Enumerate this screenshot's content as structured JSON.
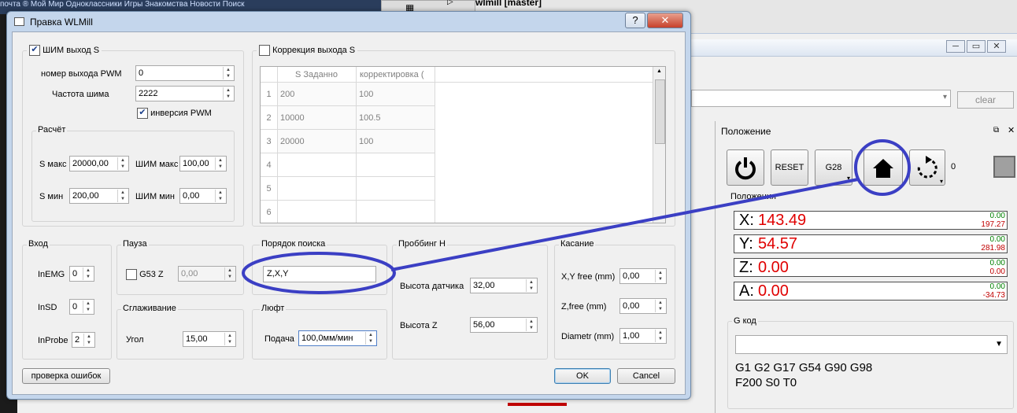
{
  "background": {
    "top_links": "почта ®  Мой Мир   Одноклассники   Игры   Знакомства   Новости   Поиск",
    "tab_title": "wlmill [master]",
    "clear_label": "clear",
    "panel_title": "Положение",
    "buttons": {
      "reset": "RESET",
      "g28": "G28",
      "spindle_count": "0"
    },
    "position_header": "Положения",
    "axes": [
      {
        "label": "X:",
        "value": "143.49",
        "sub1": "0.00",
        "sub2": "197.27"
      },
      {
        "label": "Y:",
        "value": "54.57",
        "sub1": "0.00",
        "sub2": "281.98"
      },
      {
        "label": "Z:",
        "value": "0.00",
        "sub1": "0.00",
        "sub2": "0.00"
      },
      {
        "label": "A:",
        "value": "0.00",
        "sub1": "0.00",
        "sub2": "-34.73"
      }
    ],
    "gcode_title": "G код",
    "gcode_line1": "G1 G2 G17 G54 G90 G98",
    "gcode_line2": "F200 S0 T0"
  },
  "dialog": {
    "title": "Правка WLMill",
    "help": "?",
    "close": "✕",
    "pwm": {
      "checkbox_label": "ШИМ выход S",
      "checked": true,
      "output_label": "номер выхода PWM",
      "output_value": "0",
      "freq_label": "Частота шима",
      "freq_value": "2222",
      "invert_label": "инверсия PWM",
      "invert_checked": true
    },
    "calc": {
      "title": "Расчёт",
      "smax_label": "S макс",
      "smax_value": "20000,00",
      "pwmmax_label": "ШИМ макс",
      "pwmmax_value": "100,00",
      "smin_label": "S мин",
      "smin_value": "200,00",
      "pwmmin_label": "ШИМ мин",
      "pwmmin_value": "0,00"
    },
    "correction": {
      "checkbox_label": "Коррекция выхода S",
      "checked": false,
      "columns": [
        "S Заданно",
        "корректировка  ("
      ],
      "rows": [
        {
          "n": "1",
          "s": "200",
          "c": "100"
        },
        {
          "n": "2",
          "s": "10000",
          "c": "100.5"
        },
        {
          "n": "3",
          "s": "20000",
          "c": "100"
        },
        {
          "n": "4",
          "s": "",
          "c": ""
        },
        {
          "n": "5",
          "s": "",
          "c": ""
        },
        {
          "n": "6",
          "s": "",
          "c": ""
        }
      ]
    },
    "input": {
      "title": "Вход",
      "inemg_label": "InEMG",
      "inemg_value": "0",
      "insd_label": "InSD",
      "insd_value": "0",
      "inprobe_label": "InProbe",
      "inprobe_value": "2"
    },
    "pause": {
      "title": "Пауза",
      "g53z_label": "G53 Z",
      "g53z_value": "0,00"
    },
    "smoothing": {
      "title": "Сглаживание",
      "angle_label": "Угол",
      "angle_value": "15,00"
    },
    "search_order": {
      "title": "Порядок поиска",
      "value": "Z,X,Y"
    },
    "backlash": {
      "title": "Люфт",
      "feed_label": "Подача",
      "feed_value": "100,0мм/мин"
    },
    "probe_h": {
      "title": "Проббинг H",
      "sensor_label": "Высота датчика",
      "sensor_value": "32,00",
      "z_label": "Высота Z",
      "z_value": "56,00"
    },
    "touch": {
      "title": "Касание",
      "xy_label": "X,Y free (mm)",
      "xy_value": "0,00",
      "z_label": "Z,free (mm)",
      "z_value": "0,00",
      "d_label": "Diametr (mm)",
      "d_value": "1,00"
    },
    "check_errors": "проверка ошибок",
    "ok": "OK",
    "cancel": "Cancel"
  },
  "annotation_color": "#3b3fc4"
}
